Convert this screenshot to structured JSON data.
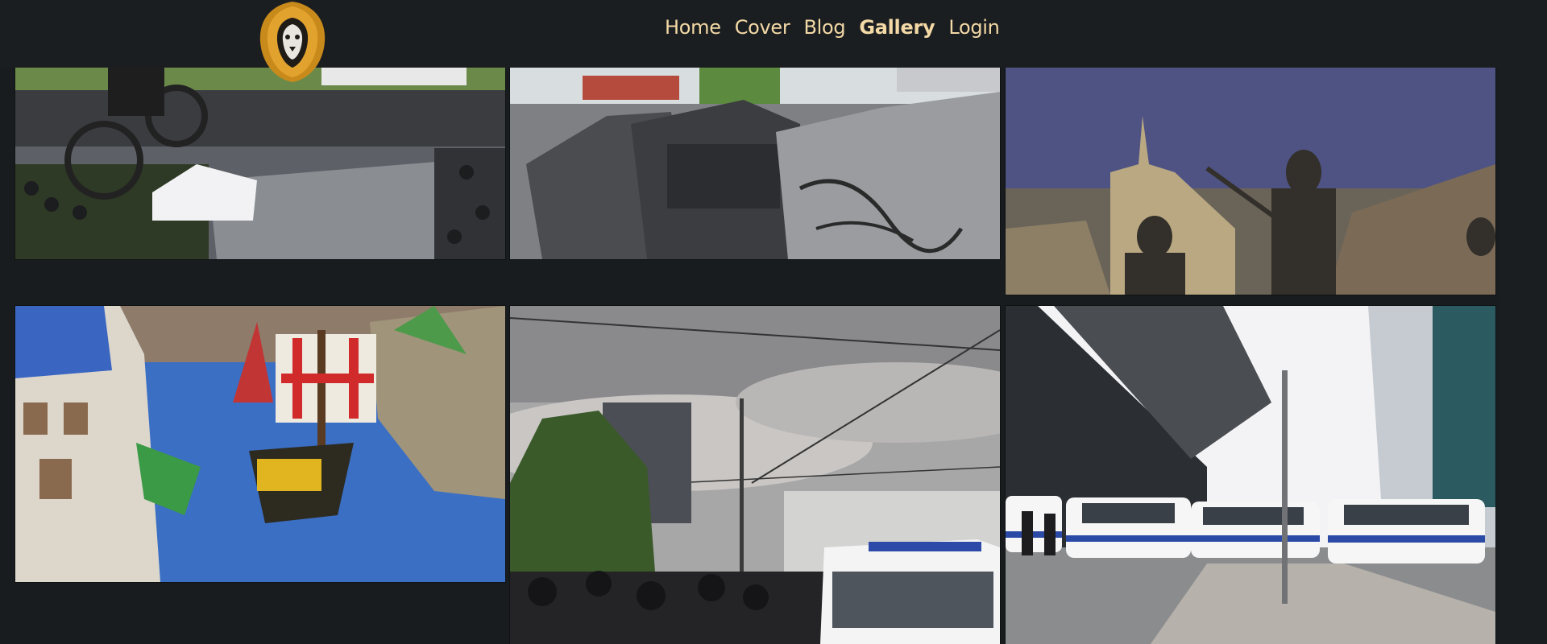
{
  "nav": {
    "items": [
      {
        "label": "Home",
        "active": false
      },
      {
        "label": "Cover",
        "active": false
      },
      {
        "label": "Blog",
        "active": false
      },
      {
        "label": "Gallery",
        "active": true
      },
      {
        "label": "Login",
        "active": false
      }
    ]
  },
  "logo": {
    "icon": "lion-head-logo-icon"
  },
  "gallery": {
    "photos": [
      {
        "name": "photo-bmx-festival",
        "subject": "BMX rider above crowd at outdoor event"
      },
      {
        "name": "photo-armored-vehicles",
        "subject": "row of armored vehicles"
      },
      {
        "name": "photo-band-mosaic",
        "subject": "band silhouettes over building mosaic"
      },
      {
        "name": "photo-lego-harbor",
        "subject": "LEGO castle harbor with pirate ship"
      },
      {
        "name": "photo-street-protest",
        "subject": "crowd and police van under cloudy sky"
      },
      {
        "name": "photo-police-vans",
        "subject": "police vans at station square"
      }
    ]
  },
  "colors": {
    "background": "#181c1e",
    "navbar": "#1b1e20",
    "nav_text": "#f3d9a6"
  }
}
